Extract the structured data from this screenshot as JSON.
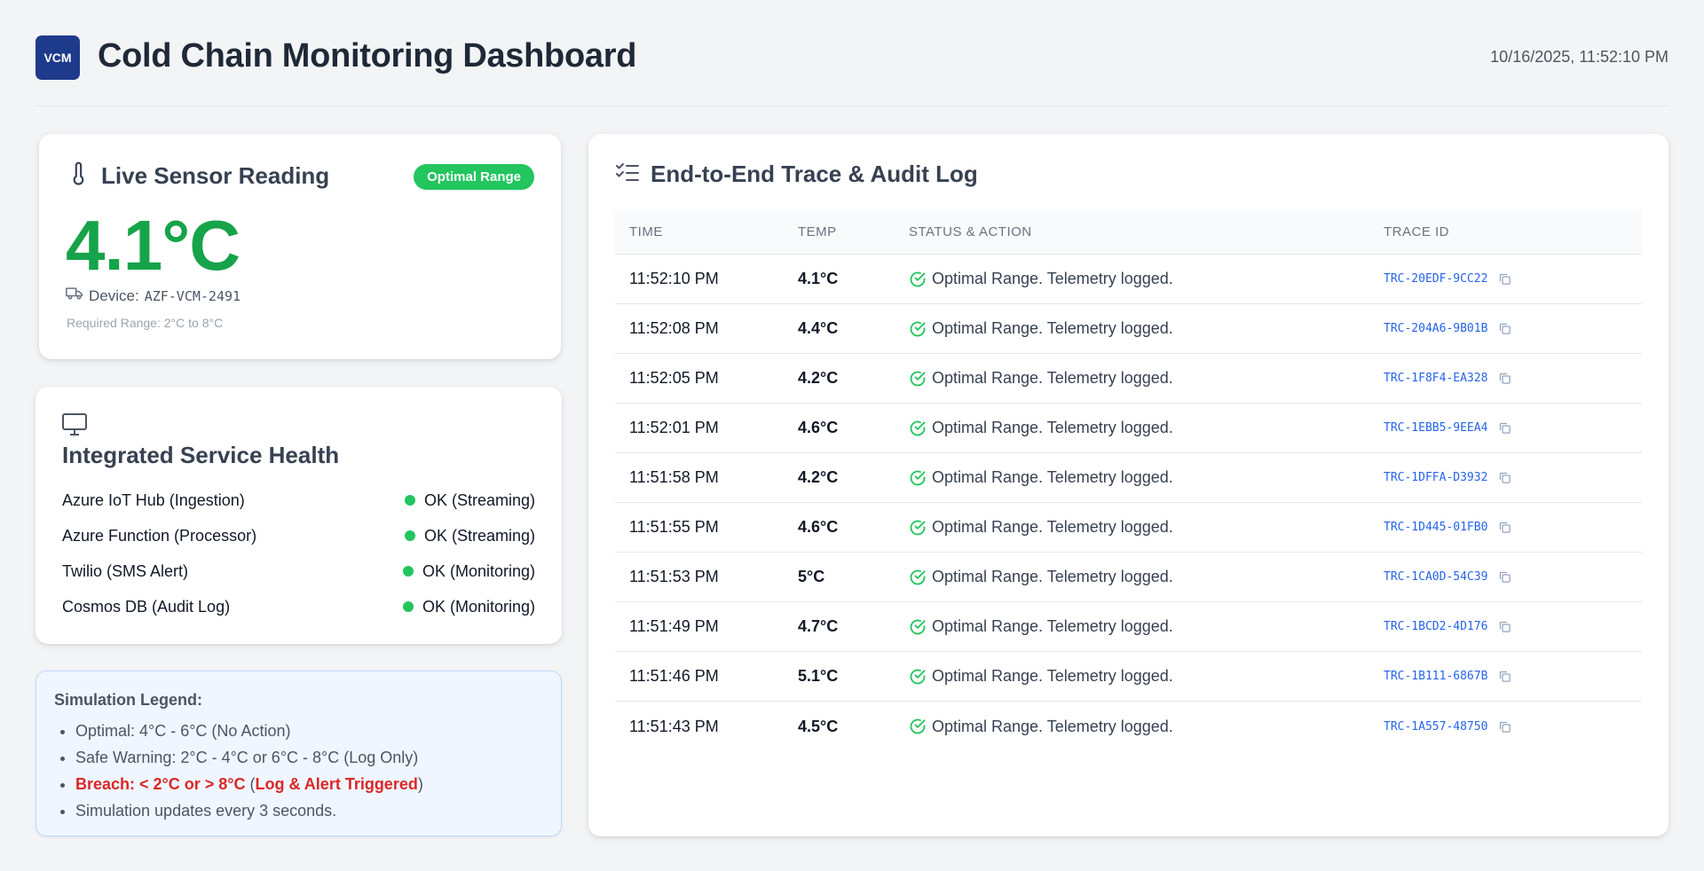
{
  "header": {
    "logo_text": "VCM",
    "title": "Cold Chain Monitoring Dashboard",
    "timestamp": "10/16/2025, 11:52:10 PM"
  },
  "sensor": {
    "title": "Live Sensor Reading",
    "badge": "Optimal Range",
    "temperature": "4.1°C",
    "device_label": "Device:",
    "device_id": "AZF-VCM-2491",
    "required_range": "Required Range: 2°C to 8°C"
  },
  "health": {
    "title": "Integrated Service Health",
    "services": [
      {
        "name": "Azure IoT Hub (Ingestion)",
        "status": "OK (Streaming)"
      },
      {
        "name": "Azure Function (Processor)",
        "status": "OK (Streaming)"
      },
      {
        "name": "Twilio (SMS Alert)",
        "status": "OK (Monitoring)"
      },
      {
        "name": "Cosmos DB (Audit Log)",
        "status": "OK (Monitoring)"
      }
    ]
  },
  "legend": {
    "title": "Simulation Legend:",
    "optimal": "Optimal: 4°C - 6°C (No Action)",
    "warning": "Safe Warning: 2°C - 4°C or 6°C - 8°C (Log Only)",
    "breach_label": "Breach: < 2°C or > 8°C",
    "breach_open": " (",
    "breach_action": "Log & Alert Triggered",
    "breach_close": ")",
    "updates": "Simulation updates every 3 seconds."
  },
  "audit": {
    "title": "End-to-End Trace & Audit Log",
    "columns": [
      "TIME",
      "TEMP",
      "STATUS & ACTION",
      "TRACE ID"
    ],
    "rows": [
      {
        "time": "11:52:10 PM",
        "temp": "4.1°C",
        "status": "Optimal Range. Telemetry logged.",
        "trace": "TRC-20EDF-9CC22"
      },
      {
        "time": "11:52:08 PM",
        "temp": "4.4°C",
        "status": "Optimal Range. Telemetry logged.",
        "trace": "TRC-204A6-9B01B"
      },
      {
        "time": "11:52:05 PM",
        "temp": "4.2°C",
        "status": "Optimal Range. Telemetry logged.",
        "trace": "TRC-1F8F4-EA328"
      },
      {
        "time": "11:52:01 PM",
        "temp": "4.6°C",
        "status": "Optimal Range. Telemetry logged.",
        "trace": "TRC-1EBB5-9EEA4"
      },
      {
        "time": "11:51:58 PM",
        "temp": "4.2°C",
        "status": "Optimal Range. Telemetry logged.",
        "trace": "TRC-1DFFA-D3932"
      },
      {
        "time": "11:51:55 PM",
        "temp": "4.6°C",
        "status": "Optimal Range. Telemetry logged.",
        "trace": "TRC-1D445-01FB0"
      },
      {
        "time": "11:51:53 PM",
        "temp": "5°C",
        "status": "Optimal Range. Telemetry logged.",
        "trace": "TRC-1CA0D-54C39"
      },
      {
        "time": "11:51:49 PM",
        "temp": "4.7°C",
        "status": "Optimal Range. Telemetry logged.",
        "trace": "TRC-1BCD2-4D176"
      },
      {
        "time": "11:51:46 PM",
        "temp": "5.1°C",
        "status": "Optimal Range. Telemetry logged.",
        "trace": "TRC-1B111-6867B"
      },
      {
        "time": "11:51:43 PM",
        "temp": "4.5°C",
        "status": "Optimal Range. Telemetry logged.",
        "trace": "TRC-1A557-48750"
      }
    ]
  },
  "colors": {
    "accent": "#1e3a8a",
    "optimal": "#22c55e",
    "temp_text": "#16a34a",
    "breach": "#dc2626",
    "trace_link": "#2563eb"
  },
  "icons": {
    "sensor": "thermometer-icon",
    "device": "truck-icon",
    "health": "monitor-icon",
    "audit": "list-checks-icon",
    "status": "check-circle-icon",
    "copy": "copy-icon"
  }
}
